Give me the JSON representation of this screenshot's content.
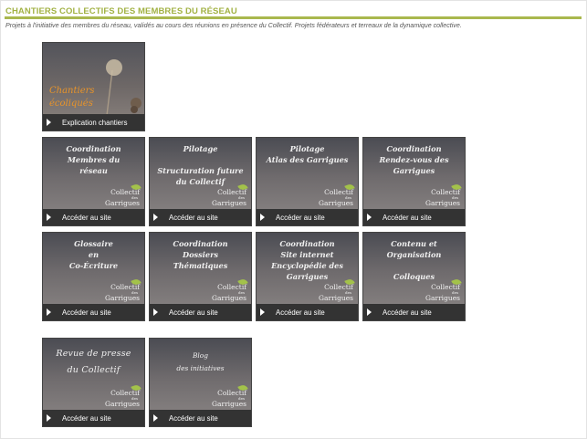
{
  "header": {
    "title": "CHANTIERS COLLECTIFS DES MEMBRES DU RÉSEAU",
    "subtitle": "Projets à l'initiative des membres du réseau, validés au cours des réunions en présence du Collectif. Projets fédérateurs et terreaux de la dynamique collective."
  },
  "intro_tile": {
    "title": "Chantiers\nécoliqués",
    "link_label": "Explication chantiers"
  },
  "logo": {
    "line1": "Collectif",
    "line2": "des",
    "line3": "Garrigues"
  },
  "tiles": [
    {
      "title": "Coordination\nMembres du\nréseau",
      "link_label": "Accéder au site"
    },
    {
      "title": "Pilotage\n\nStructuration future\ndu Collectif",
      "link_label": "Accéder au site"
    },
    {
      "title": "Pilotage\nAtlas des Garrigues",
      "link_label": "Accéder au site"
    },
    {
      "title": "Coordination\nRendez-vous des\nGarrigues",
      "link_label": "Accéder au site"
    },
    {
      "title": "Glossaire\nen\nCo-Écriture",
      "link_label": "Accéder au site"
    },
    {
      "title": "Coordination\nDossiers\nThématiques",
      "link_label": "Accéder au site"
    },
    {
      "title": "Coordination\nSite internet\nEncyclopédie des\nGarrigues",
      "link_label": "Accéder au site"
    },
    {
      "title": "Contenu et\nOrganisation\n\nColloques",
      "link_label": "Accéder au site"
    },
    {
      "title": "Revue de presse\ndu Collectif",
      "link_label": "Accéder au site"
    },
    {
      "title": "Blog\ndes initiatives",
      "link_label": "Accéder au site"
    }
  ]
}
